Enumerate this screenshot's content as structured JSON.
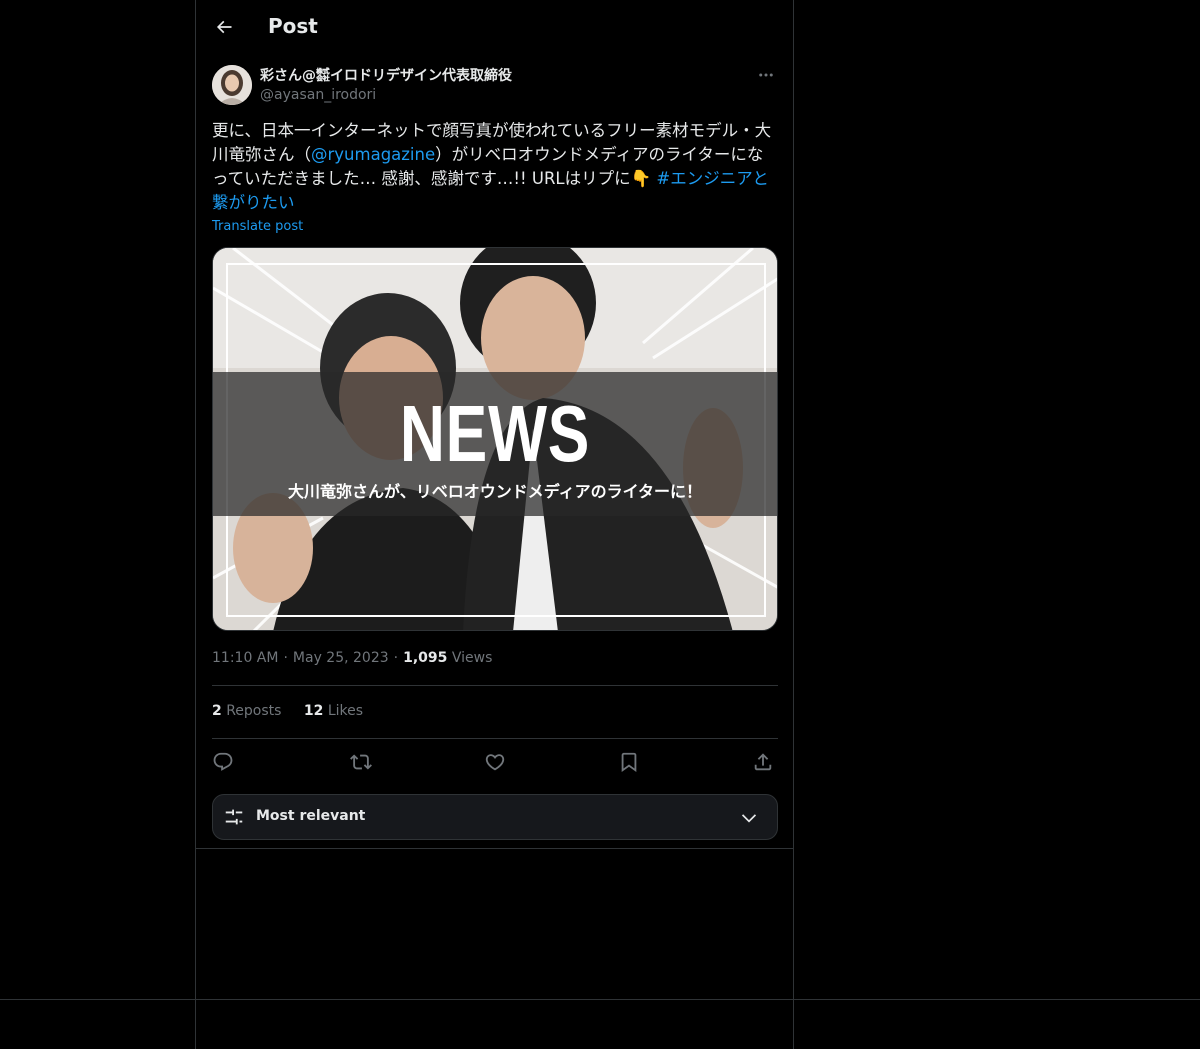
{
  "header": {
    "title": "Post"
  },
  "author": {
    "display_name": "彩さん@㍿イロドリデザイン代表取締役",
    "handle": "@ayasan_irodori"
  },
  "tweet": {
    "text_part1": "更に、日本一インターネットで顔写真が使われているフリー素材モデル・大川竜弥さん（",
    "mention": "@ryumagazine",
    "text_part2": "）がリベロオウンドメディアのライターになっていただきました… 感謝、感謝です…!! URLはリプに👇 ",
    "hashtag": "#エンジニアと繋がりたい",
    "translate_label": "Translate post"
  },
  "media": {
    "headline": "NEWS",
    "subtitle": "大川竜弥さんが、リベロオウンドメディアのライターに！"
  },
  "meta": {
    "time": "11:10 AM",
    "date": "May 25, 2023",
    "views_count": "1,095",
    "views_label": "Views",
    "separator": "·"
  },
  "stats": {
    "reposts_count": "2",
    "reposts_label": "Reposts",
    "likes_count": "12",
    "likes_label": "Likes"
  },
  "actions": [
    "reply-icon",
    "repost-icon",
    "like-icon",
    "bookmark-icon",
    "share-icon"
  ],
  "sort": {
    "label": "Most relevant"
  },
  "colors": {
    "background": "#000000",
    "text": "#e7e9ea",
    "secondary": "#71767b",
    "accent": "#1d9bf0",
    "border": "#2f3336"
  }
}
